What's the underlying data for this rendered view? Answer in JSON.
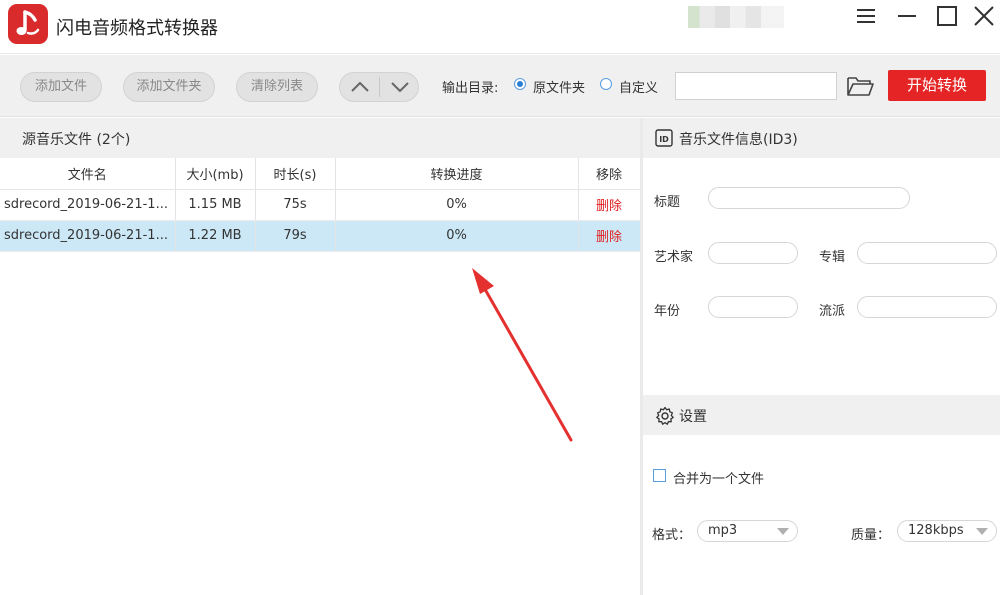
{
  "app": {
    "title": "闪电音频格式转换器"
  },
  "toolbar": {
    "add_file": "添加文件",
    "add_folder": "添加文件夹",
    "clear_list": "清除列表",
    "output_dir_label": "输出目录:",
    "option_source_folder": "原文件夹",
    "option_custom": "自定义",
    "selected_option": "原文件夹",
    "output_path_value": "",
    "start_button": "开始转换"
  },
  "file_list": {
    "header": "源音乐文件 (2个)",
    "columns": [
      "文件名",
      "大小(mb)",
      "时长(s)",
      "转换进度",
      "移除"
    ],
    "rows": [
      {
        "name": "sdrecord_2019-06-21-1...",
        "size": "1.15 MB",
        "duration": "75s",
        "progress": "0%",
        "remove": "删除",
        "selected": false
      },
      {
        "name": "sdrecord_2019-06-21-1...",
        "size": "1.22 MB",
        "duration": "79s",
        "progress": "0%",
        "remove": "删除",
        "selected": true
      }
    ]
  },
  "id3": {
    "header": "音乐文件信息(ID3)",
    "title_label": "标题",
    "artist_label": "艺术家",
    "album_label": "专辑",
    "year_label": "年份",
    "genre_label": "流派",
    "title_value": "",
    "artist_value": "",
    "album_value": "",
    "year_value": "",
    "genre_value": ""
  },
  "settings": {
    "header": "设置",
    "merge_label": "合并为一个文件",
    "merge_checked": false,
    "format_label": "格式：",
    "format_value": "mp3",
    "quality_label": "质量：",
    "quality_value": "128kbps"
  },
  "colors": {
    "accent_red": "#e52525",
    "selection_blue": "#cce8f7",
    "delete_red": "#e02020"
  }
}
